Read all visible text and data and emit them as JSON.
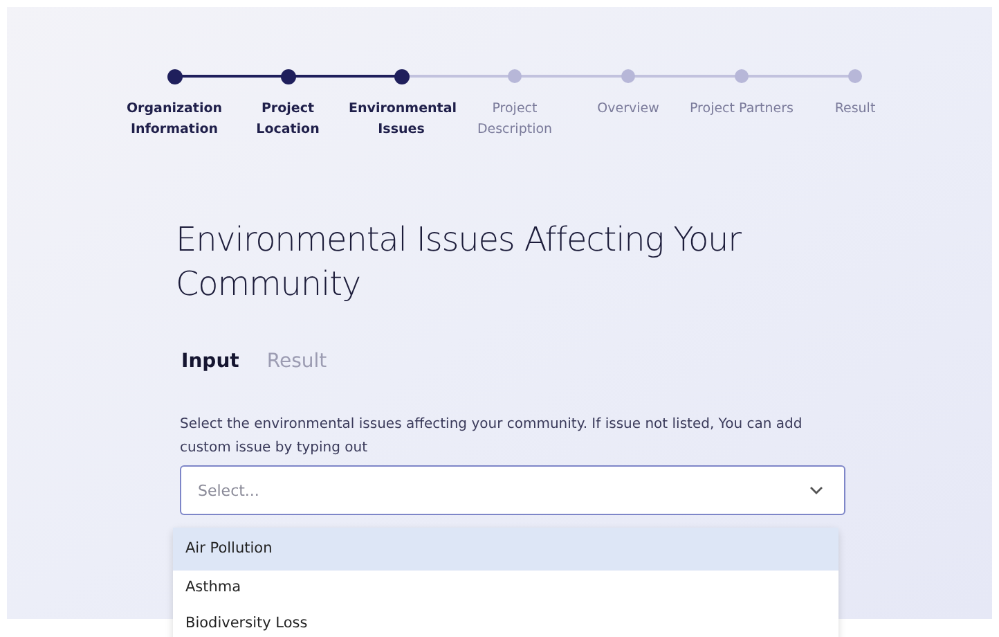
{
  "steps": [
    {
      "label": "Organization Information",
      "reached": true
    },
    {
      "label": "Project Location",
      "reached": true
    },
    {
      "label": "Environmental Issues",
      "reached": true
    },
    {
      "label": "Project Description",
      "reached": false
    },
    {
      "label": "Overview",
      "reached": false
    },
    {
      "label": "Project Partners",
      "reached": false
    },
    {
      "label": "Result",
      "reached": false
    }
  ],
  "title": "Environmental Issues Affecting Your Community",
  "tabs": [
    {
      "label": "Input",
      "selected": true
    },
    {
      "label": "Result",
      "selected": false
    }
  ],
  "description": "Select the environmental issues affecting your community. If issue not listed, You can add custom issue by typing out",
  "select": {
    "placeholder": "Select..."
  },
  "options": [
    {
      "label": "Air Pollution",
      "selected": true
    },
    {
      "label": "Asthma",
      "selected": false
    },
    {
      "label": "Biodiversity Loss",
      "selected": false
    }
  ]
}
